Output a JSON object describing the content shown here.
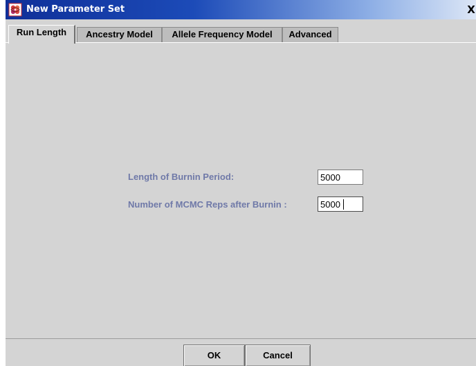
{
  "window": {
    "title": "New Parameter Set",
    "close_glyph": "X",
    "icon": "app-icon"
  },
  "tabs": [
    {
      "label": "Run Length",
      "active": true
    },
    {
      "label": "Ancestry Model",
      "active": false
    },
    {
      "label": "Allele Frequency Model",
      "active": false
    },
    {
      "label": "Advanced",
      "active": false
    }
  ],
  "run_length": {
    "burnin_label": "Length of Burnin Period:",
    "burnin_value": "5000",
    "reps_label": "Number of MCMC Reps after Burnin :",
    "reps_value": "5000"
  },
  "buttons": {
    "ok_label": "OK",
    "cancel_label": "Cancel"
  },
  "colors": {
    "label_text": "#6f79a8",
    "titlebar_start": "#0f2f98",
    "titlebar_end": "#dce6f6",
    "panel_bg": "#d4d4d4"
  }
}
